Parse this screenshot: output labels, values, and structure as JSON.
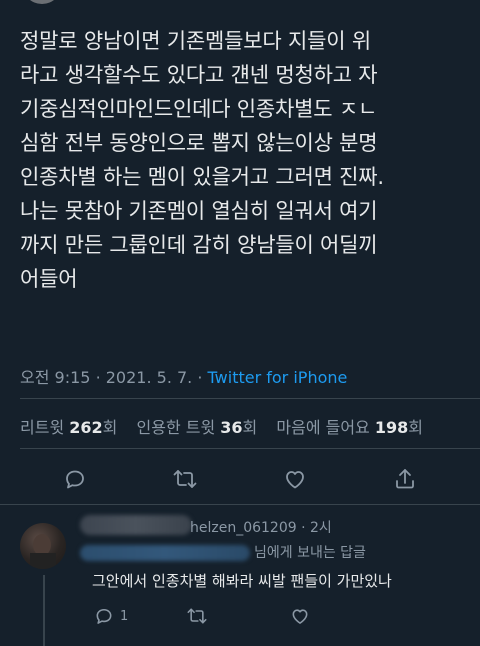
{
  "tweet": {
    "text": "정말로 양남이면 기존멤들보다 지들이 위\n라고 생각할수도 있다고 걘넨 멍청하고 자\n기중심적인마인드인데다 인종차별도 ㅈㄴ\n심함 전부 동양인으로 뽑지 않는이상 분명\n인종차별 하는 멤이 있을거고 그러면 진짜.\n나는 못참아 기존멤이 열심히 일궈서 여기\n까지 만든 그룹인데 감히 양남들이 어딜끼\n어들어",
    "time": "오전 9:15",
    "date": "2021. 5. 7.",
    "separator": "·",
    "source": "Twitter for iPhone"
  },
  "stats": {
    "retweets_label": "리트윗",
    "retweets_count": "262",
    "retweets_unit": "회",
    "quotes_label": "인용한 트윗",
    "quotes_count": "36",
    "quotes_unit": "회",
    "likes_label": "마음에 들어요",
    "likes_count": "198",
    "likes_unit": "회"
  },
  "actions": {
    "icons": [
      "reply-icon",
      "retweet-icon",
      "like-icon",
      "share-icon"
    ]
  },
  "reply": {
    "handle_suffix": "helzen_061209 · 2시",
    "replying_to_suffix": "님에게 보내는 답글",
    "text": "그안에서 인종차별 해봐라  씨발 팬들이 가만있나",
    "reply_count": "1"
  },
  "colors": {
    "background": "#15202b",
    "text": "#e7e9ea",
    "secondary": "#8b98a5",
    "link": "#1d9bf0",
    "border": "#38444d"
  }
}
